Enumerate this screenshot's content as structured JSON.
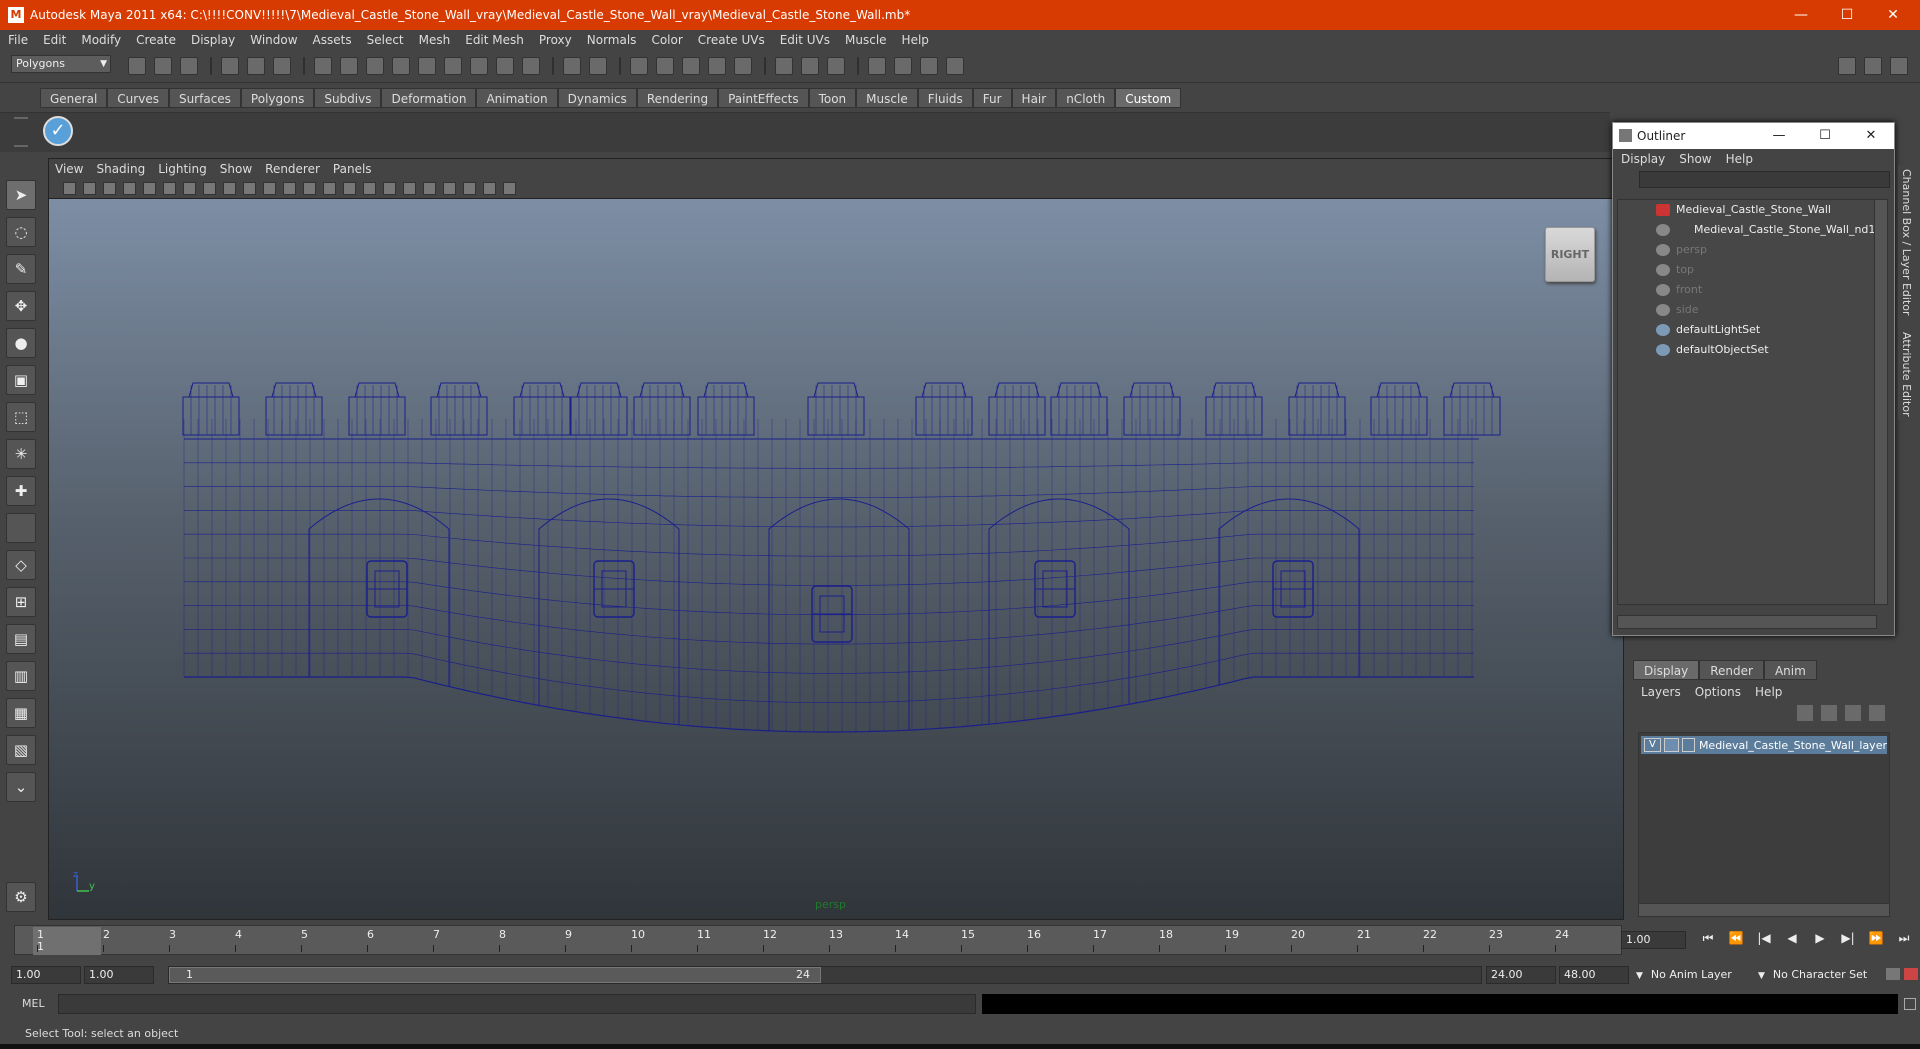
{
  "window": {
    "title": "Autodesk Maya 2011 x64: C:\\!!!!CONV!!!!!\\7\\Medieval_Castle_Stone_Wall_vray\\Medieval_Castle_Stone_Wall_vray\\Medieval_Castle_Stone_Wall.mb*",
    "minimize": "—",
    "maximize": "☐",
    "close": "✕"
  },
  "menubar": [
    "File",
    "Edit",
    "Modify",
    "Create",
    "Display",
    "Window",
    "Assets",
    "Select",
    "Mesh",
    "Edit Mesh",
    "Proxy",
    "Normals",
    "Color",
    "Create UVs",
    "Edit UVs",
    "Muscle",
    "Help"
  ],
  "statusline": {
    "mode": "Polygons"
  },
  "shelf": {
    "tabs": [
      "General",
      "Curves",
      "Surfaces",
      "Polygons",
      "Subdivs",
      "Deformation",
      "Animation",
      "Dynamics",
      "Rendering",
      "PaintEffects",
      "Toon",
      "Muscle",
      "Fluids",
      "Fur",
      "Hair",
      "nCloth",
      "Custom"
    ],
    "active": "Custom"
  },
  "viewport": {
    "menu": [
      "View",
      "Shading",
      "Lighting",
      "Show",
      "Renderer",
      "Panels"
    ],
    "viewcube_label": "RIGHT",
    "camera_label": "persp",
    "axis_z": "z",
    "axis_y": "y",
    "wire_color": "#1a1f8c"
  },
  "outliner": {
    "title": "Outliner",
    "menu": [
      "Display",
      "Show",
      "Help"
    ],
    "items": [
      {
        "label": "Medieval_Castle_Stone_Wall",
        "dim": false
      },
      {
        "label": "Medieval_Castle_Stone_Wall_nd1_",
        "dim": false
      },
      {
        "label": "persp",
        "dim": true
      },
      {
        "label": "top",
        "dim": true
      },
      {
        "label": "front",
        "dim": true
      },
      {
        "label": "side",
        "dim": true
      },
      {
        "label": "defaultLightSet",
        "dim": false
      },
      {
        "label": "defaultObjectSet",
        "dim": false
      }
    ]
  },
  "side_tabs": [
    "Channel Box / Layer Editor",
    "Attribute Editor"
  ],
  "layer_editor": {
    "tabs": [
      "Display",
      "Render",
      "Anim"
    ],
    "active": "Display",
    "menu": [
      "Layers",
      "Options",
      "Help"
    ],
    "layer": {
      "visible": "V",
      "name": "Medieval_Castle_Stone_Wall_layer"
    }
  },
  "timeline": {
    "ticks": [
      "1",
      "2",
      "3",
      "4",
      "5",
      "6",
      "7",
      "8",
      "9",
      "10",
      "11",
      "12",
      "13",
      "14",
      "15",
      "16",
      "17",
      "18",
      "19",
      "20",
      "21",
      "22",
      "23",
      "24"
    ],
    "current_marker": "1",
    "current_time": "1.00",
    "controls": [
      "⏮",
      "⏪",
      "|◀",
      "◀",
      "▶",
      "▶|",
      "⏩",
      "⏭"
    ]
  },
  "range": {
    "start": "1.00",
    "playback_start": "1.00",
    "handle_start": "1",
    "handle_end": "24",
    "playback_end": "24.00",
    "end": "48.00",
    "anim_layer": "No Anim Layer",
    "character_set": "No Character Set"
  },
  "commandline": {
    "label": "MEL"
  },
  "helpline": {
    "text": "Select Tool: select an object"
  }
}
